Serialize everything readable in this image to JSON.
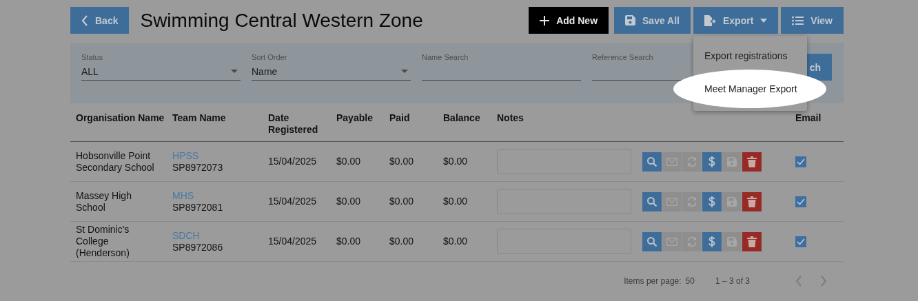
{
  "page": {
    "title": "Swimming Central Western Zone"
  },
  "header_buttons": [
    {
      "kind": "back",
      "label": "Back"
    },
    {
      "kind": "add",
      "label": "Add New"
    },
    {
      "kind": "save",
      "label": "Save All"
    },
    {
      "kind": "export",
      "label": "Export"
    },
    {
      "kind": "view",
      "label": "View"
    }
  ],
  "filters": [
    {
      "kind": "select",
      "label": "Status",
      "value": "ALL"
    },
    {
      "kind": "select",
      "label": "Sort Order",
      "value": "Name"
    },
    {
      "kind": "text",
      "label": "Name Search"
    },
    {
      "kind": "text",
      "label": "Reference Search"
    }
  ],
  "search_button": {
    "label": "ch"
  },
  "export_menu": {
    "items": [
      {
        "label": "Export registrations",
        "highlighted": false
      },
      {
        "label": "Meet Manager Export",
        "highlighted": true
      }
    ]
  },
  "table": {
    "columns": [
      "Organisation Name",
      "Team Name",
      "Date Registered",
      "Payable",
      "Paid",
      "Balance",
      "Notes",
      "Email"
    ],
    "rows": [
      {
        "organisation": "Hobsonville Point Secondary School",
        "team_code": "HPSS",
        "reference": "SP8972073",
        "date": "15/04/2025",
        "payable": "$0.00",
        "paid": "$0.00",
        "balance": "$0.00",
        "actions": [
          {
            "kind": "view",
            "disabled": false
          },
          {
            "kind": "email",
            "disabled": true
          },
          {
            "kind": "refresh",
            "disabled": true
          },
          {
            "kind": "payment",
            "disabled": false
          },
          {
            "kind": "save",
            "disabled": true
          },
          {
            "kind": "delete",
            "disabled": false
          }
        ],
        "email": true
      },
      {
        "organisation": "Massey High School",
        "team_code": "MHS",
        "reference": "SP8972081",
        "date": "15/04/2025",
        "payable": "$0.00",
        "paid": "$0.00",
        "balance": "$0.00",
        "actions": [
          {
            "kind": "view",
            "disabled": false
          },
          {
            "kind": "email",
            "disabled": true
          },
          {
            "kind": "refresh",
            "disabled": true
          },
          {
            "kind": "payment",
            "disabled": false
          },
          {
            "kind": "save",
            "disabled": true
          },
          {
            "kind": "delete",
            "disabled": false
          }
        ],
        "email": true
      },
      {
        "organisation": "St Dominic's College (Henderson)",
        "team_code": "SDCH",
        "reference": "SP8972086",
        "date": "15/04/2025",
        "payable": "$0.00",
        "paid": "$0.00",
        "balance": "$0.00",
        "actions": [
          {
            "kind": "view",
            "disabled": false
          },
          {
            "kind": "email",
            "disabled": true
          },
          {
            "kind": "refresh",
            "disabled": true
          },
          {
            "kind": "payment",
            "disabled": false
          },
          {
            "kind": "save",
            "disabled": true
          },
          {
            "kind": "delete",
            "disabled": false
          }
        ],
        "email": true
      }
    ]
  },
  "pagination": {
    "items_per_page_label": "Items per page:",
    "items_per_page": "50",
    "range": "1 – 3 of 3"
  }
}
